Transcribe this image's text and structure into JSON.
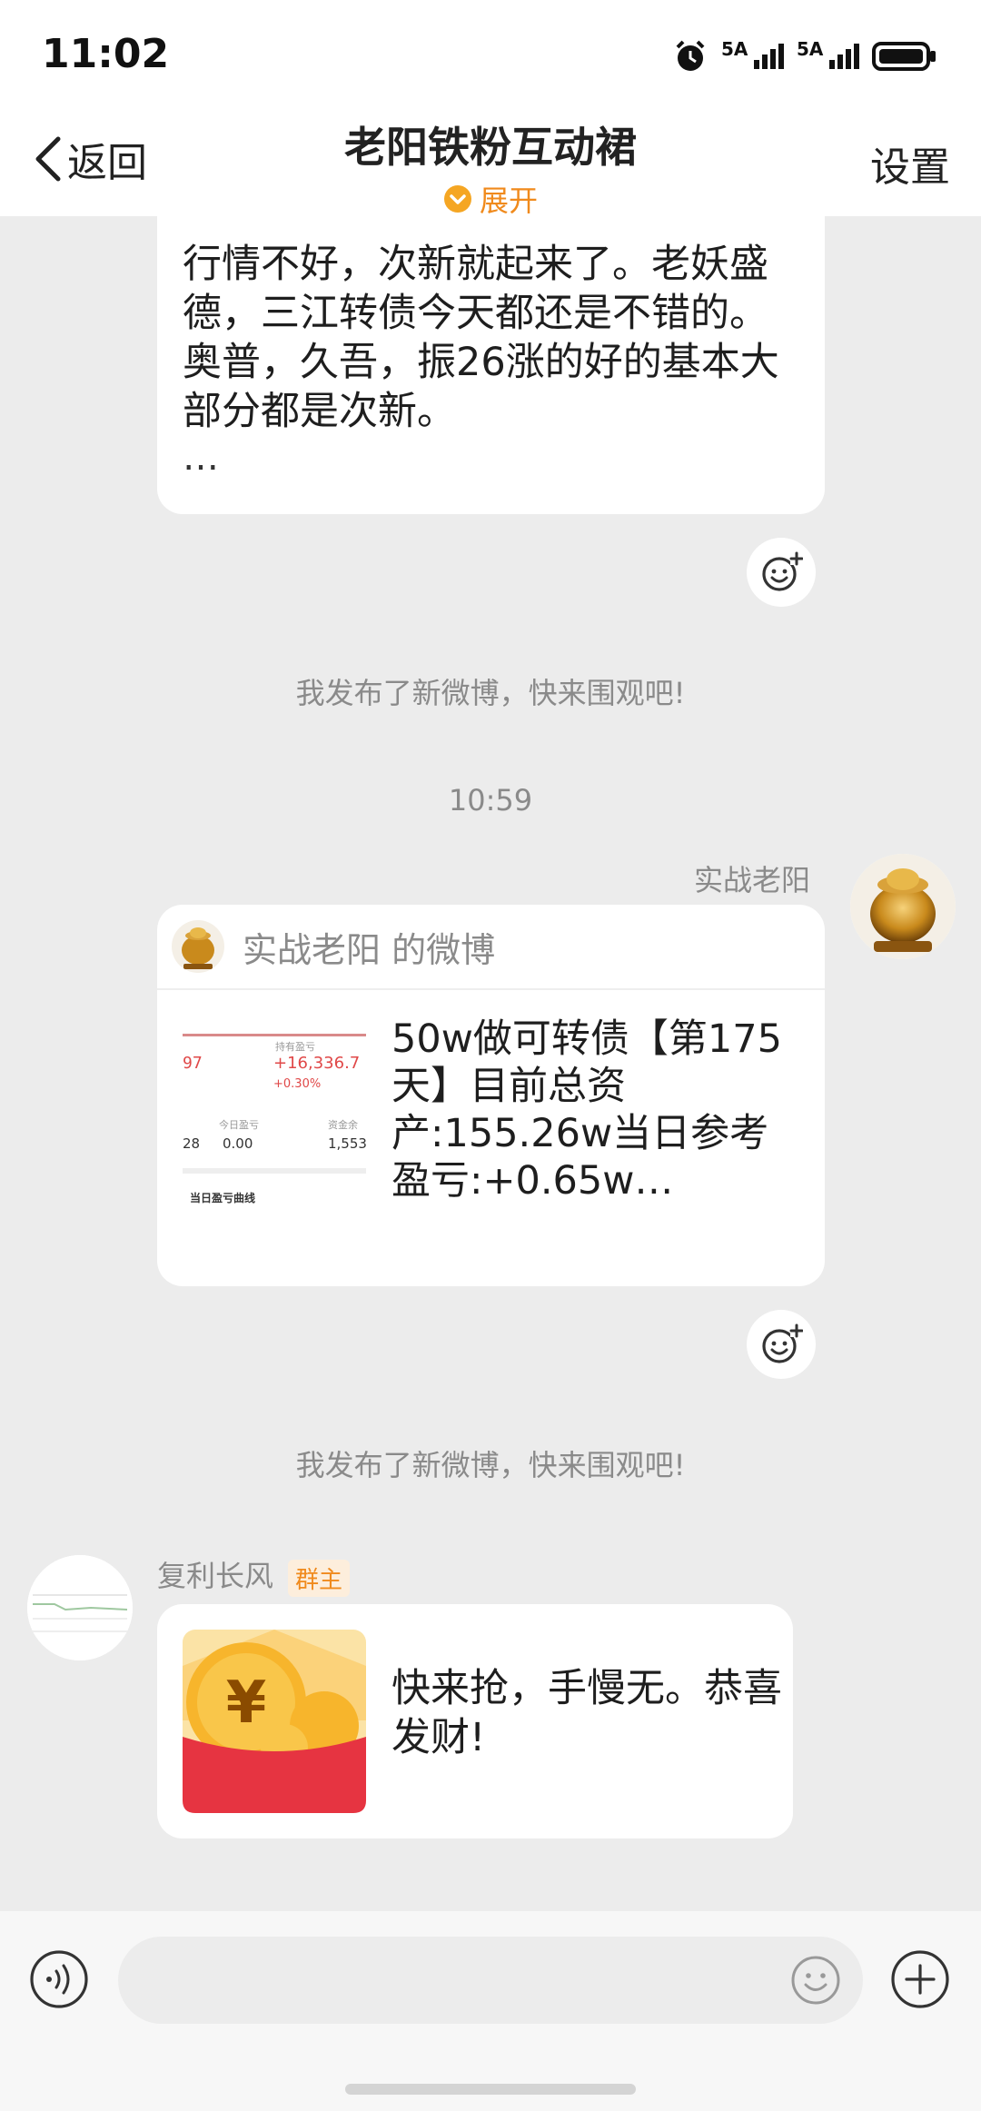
{
  "status_bar": {
    "time": "11:02",
    "sim1": "5A",
    "sim2": "5A",
    "icons": [
      "alarm-icon",
      "signal-icon",
      "signal-icon",
      "battery-icon"
    ]
  },
  "header": {
    "back_label": "返回",
    "title": "老阳铁粉互动裙",
    "expand_label": "展开",
    "settings_label": "设置"
  },
  "messages": {
    "msg1": {
      "text": "行情不好，次新就起来了。老妖盛德，三江转债今天都还是不错的。奥普，久吾，振26涨的好的基本大部分都是次新。",
      "more": "…"
    },
    "system_note_1": "我发布了新微博，快来围观吧!",
    "timestamp": "10:59",
    "weibo_card": {
      "sender": "实战老阳",
      "header_label": "实战老阳 的微博",
      "text": "50w做可转债【第175天】目前总资产:155.26w当日参考盈亏:+0.65w…",
      "thumb_values": {
        "v1": "+16,336.7",
        "v2": "+0.30%",
        "v3": "0.00",
        "v4": "1,553",
        "left1": "97",
        "left2": "28",
        "footer": "当日盈亏曲线"
      }
    },
    "system_note_2": "我发布了新微博，快来围观吧!",
    "redpacket": {
      "sender": "复利长风",
      "owner_tag": "群主",
      "text": "快来抢，手慢无。恭喜发财!"
    }
  },
  "input": {
    "placeholder": "",
    "value": ""
  },
  "colors": {
    "accent": "#f08a1c",
    "background": "#ececec",
    "bubble": "#ffffff",
    "redpacket_red": "#e63441",
    "coin_gold": "#f7b52c"
  }
}
